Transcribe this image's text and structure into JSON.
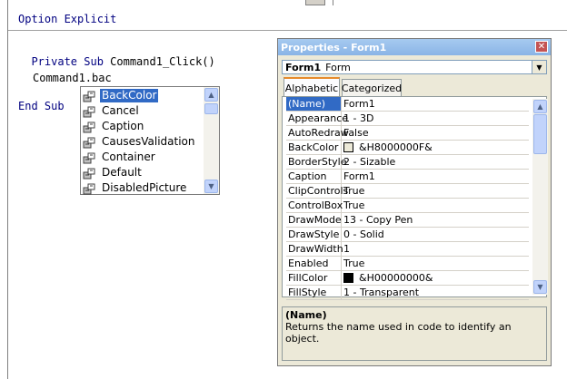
{
  "code": {
    "line1_kw": "Option Explicit",
    "line2_kw": "Private Sub",
    "line2_tx": " Command1_Click()",
    "line3": "Command1.bac",
    "line4_kw": "End Sub"
  },
  "autocomplete": {
    "items": [
      {
        "label": "BackColor",
        "selected": true
      },
      {
        "label": "Cancel",
        "selected": false
      },
      {
        "label": "Caption",
        "selected": false
      },
      {
        "label": "CausesValidation",
        "selected": false
      },
      {
        "label": "Container",
        "selected": false
      },
      {
        "label": "Default",
        "selected": false
      },
      {
        "label": "DisabledPicture",
        "selected": false
      }
    ],
    "icon": "property-icon"
  },
  "properties": {
    "title": "Properties - Form1",
    "object_name": "Form1",
    "object_type": "Form",
    "tabs": [
      "Alphabetic",
      "Categorized"
    ],
    "active_tab": "Alphabetic",
    "rows": [
      {
        "name": "(Name)",
        "value": "Form1",
        "selected": true
      },
      {
        "name": "Appearance",
        "value": "1 - 3D"
      },
      {
        "name": "AutoRedraw",
        "value": "False"
      },
      {
        "name": "BackColor",
        "value": "&H8000000F&",
        "swatch": "#ece9d8"
      },
      {
        "name": "BorderStyle",
        "value": "2 - Sizable"
      },
      {
        "name": "Caption",
        "value": "Form1"
      },
      {
        "name": "ClipControls",
        "value": "True"
      },
      {
        "name": "ControlBox",
        "value": "True"
      },
      {
        "name": "DrawMode",
        "value": "13 - Copy Pen"
      },
      {
        "name": "DrawStyle",
        "value": "0 - Solid"
      },
      {
        "name": "DrawWidth",
        "value": "1"
      },
      {
        "name": "Enabled",
        "value": "True"
      },
      {
        "name": "FillColor",
        "value": "&H00000000&",
        "swatch": "#000000"
      },
      {
        "name": "FillStyle",
        "value": "1 - Transparent"
      }
    ],
    "description_title": "(Name)",
    "description_text": "Returns the name used in code to identify an object."
  },
  "colors": {
    "keyword": "#000080",
    "selection": "#316ac5",
    "title_bar": "#a6caf0"
  }
}
